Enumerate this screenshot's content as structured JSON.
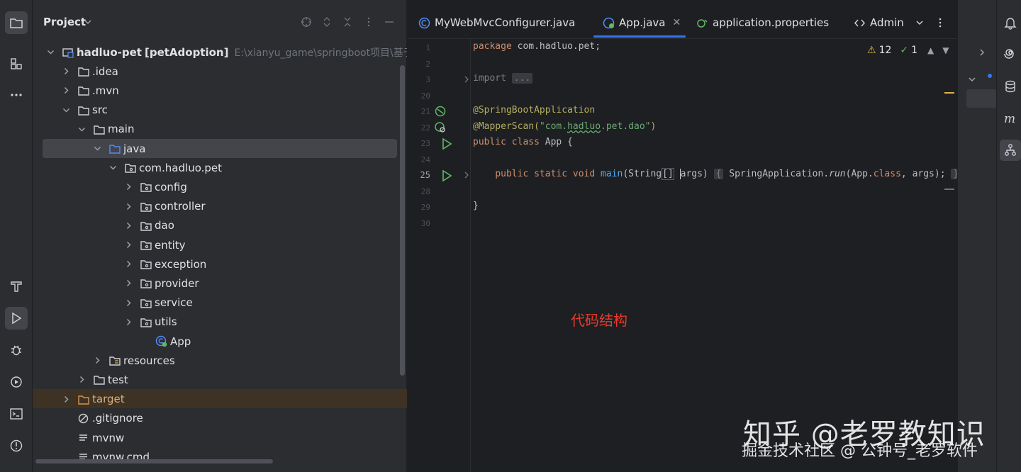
{
  "project_panel": {
    "title": "Project",
    "tree": [
      {
        "label": "hadluo-pet",
        "suffix": "[petAdoption]",
        "path": "E:\\xianyu_game\\springboot项目\\基于spr"
      },
      {
        "label": ".idea"
      },
      {
        "label": ".mvn"
      },
      {
        "label": "src"
      },
      {
        "label": "main"
      },
      {
        "label": "java"
      },
      {
        "label": "com.hadluo.pet"
      },
      {
        "label": "config"
      },
      {
        "label": "controller"
      },
      {
        "label": "dao"
      },
      {
        "label": "entity"
      },
      {
        "label": "exception"
      },
      {
        "label": "provider"
      },
      {
        "label": "service"
      },
      {
        "label": "utils"
      },
      {
        "label": "App"
      },
      {
        "label": "resources"
      },
      {
        "label": "test"
      },
      {
        "label": "target"
      },
      {
        "label": ".gitignore"
      },
      {
        "label": "mvnw"
      },
      {
        "label": "mvnw.cmd"
      }
    ]
  },
  "tabs": [
    {
      "label": "MyWebMvcConfigurer.java"
    },
    {
      "label": "App.java",
      "active": true
    },
    {
      "label": "application.properties"
    },
    {
      "label": "Admin"
    }
  ],
  "editor": {
    "inspections": {
      "warnings": "12",
      "ok": "1"
    },
    "line_numbers": [
      "1",
      "2",
      "3",
      "20",
      "21",
      "22",
      "23",
      "24",
      "25",
      "28",
      "29",
      "30"
    ],
    "code": {
      "l1_kw": "package",
      "l1_rest": " com.hadluo.pet;",
      "l3_kw": "import",
      "l3_fold": "...",
      "l21": "@SpringBootApplication",
      "l22_ann": "@MapperScan(",
      "l22_str_a": "\"com.",
      "l22_str_b": "hadluo",
      "l22_str_c": ".pet.dao\"",
      "l22_close": ")",
      "l23_kw": "public class",
      "l23_rest": " App {",
      "l25_kw": "public static void",
      "l25_fn": "main",
      "l25_params_a": "(String",
      "l25_brackets": "[]",
      "l25_params_b": "rgs)",
      "l25_a": "a",
      "l25_body_open": "{",
      "l25_body_a": " SpringApplication.",
      "l25_run": "run",
      "l25_body_b": "(App.",
      "l25_class": "class",
      "l25_body_c": ", ",
      "l25_args": "args",
      "l25_body_d": ");",
      "l25_body_close": "}",
      "l29": "}"
    },
    "annotation": "代码结构"
  },
  "watermark": {
    "main": "知乎 @老罗教知识",
    "sub": "掘金技术社区 @ 公钟号_老罗软件"
  },
  "colors": {
    "accent": "#3574f0",
    "annotation": "#e63b2e",
    "excluded_bg": "#3d3223"
  }
}
